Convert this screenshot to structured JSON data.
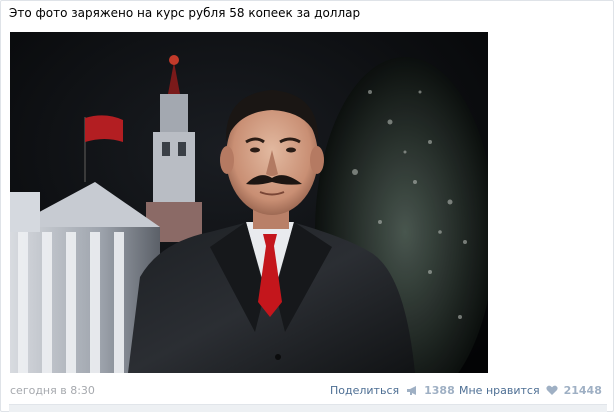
{
  "post": {
    "text": "Это фото заряжено на курс рубля 58 копеек за доллар",
    "photo_alt": "",
    "date": "сегодня в 8:30",
    "share": {
      "label": "Поделиться",
      "icon": "megaphone-icon",
      "count": "1388"
    },
    "like": {
      "label": "Мне нравится",
      "icon": "heart-icon",
      "count": "21448"
    }
  },
  "colors": {
    "link": "#4e6f94",
    "muted": "#a6a9ae",
    "count": "#9fb0c4",
    "tie": "#c4161c",
    "background": "#ffffff"
  }
}
